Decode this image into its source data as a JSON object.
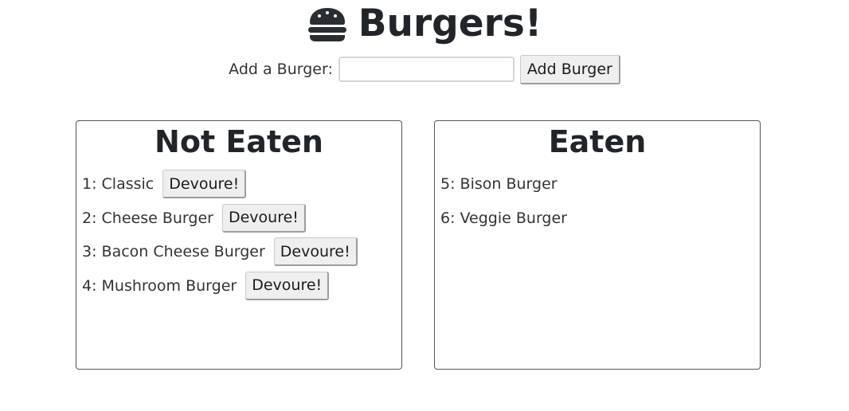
{
  "header": {
    "icon": "hamburger-icon",
    "title": "Burgers!"
  },
  "add_form": {
    "label": "Add a Burger:",
    "input_value": "",
    "input_placeholder": "",
    "button_label": "Add Burger"
  },
  "not_eaten": {
    "title": "Not Eaten",
    "button_label": "Devoure!",
    "items": [
      {
        "text": "1: Classic"
      },
      {
        "text": "2: Cheese Burger"
      },
      {
        "text": "3: Bacon Cheese Burger"
      },
      {
        "text": "4: Mushroom Burger"
      }
    ]
  },
  "eaten": {
    "title": "Eaten",
    "items": [
      {
        "text": "5: Bison Burger"
      },
      {
        "text": "6: Veggie Burger"
      }
    ]
  },
  "colors": {
    "text": "#212529",
    "button_bg": "#efefef",
    "panel_border": "#555555"
  }
}
